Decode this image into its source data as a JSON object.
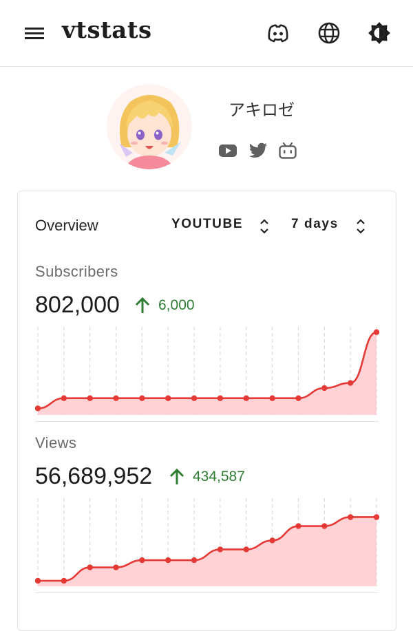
{
  "header": {
    "brand": "vtstats",
    "icons": [
      "menu-icon",
      "discord-icon",
      "globe-icon",
      "theme-brightness-icon"
    ]
  },
  "profile": {
    "name": "アキロゼ",
    "social_icons": [
      "youtube-icon",
      "twitter-icon",
      "bilibili-icon"
    ]
  },
  "overview": {
    "title": "Overview",
    "platform_select": "YOUTUBE",
    "range_select": "7 days"
  },
  "metrics": [
    {
      "label": "Subscribers",
      "value": "802,000",
      "delta": "6,000"
    },
    {
      "label": "Views",
      "value": "56,689,952",
      "delta": "434,587"
    }
  ],
  "colors": {
    "chart_line": "#e53935",
    "chart_fill": "#ffcdd2",
    "delta_up": "#2e7d32"
  },
  "chart_data": [
    {
      "type": "area",
      "series": [
        {
          "values": [
            796000,
            796800,
            796800,
            796800,
            796800,
            796800,
            796800,
            796800,
            796800,
            796800,
            796800,
            797600,
            798000,
            802000
          ]
        }
      ],
      "ylim": [
        795700,
        802200
      ]
    },
    {
      "type": "area",
      "series": [
        {
          "values": [
            56255365,
            56255365,
            56330000,
            56330000,
            56370000,
            56370000,
            56370000,
            56430000,
            56430000,
            56480000,
            56560000,
            56560000,
            56610000,
            56610000
          ]
        }
      ],
      "ylim": [
        56240000,
        56700000
      ]
    }
  ]
}
